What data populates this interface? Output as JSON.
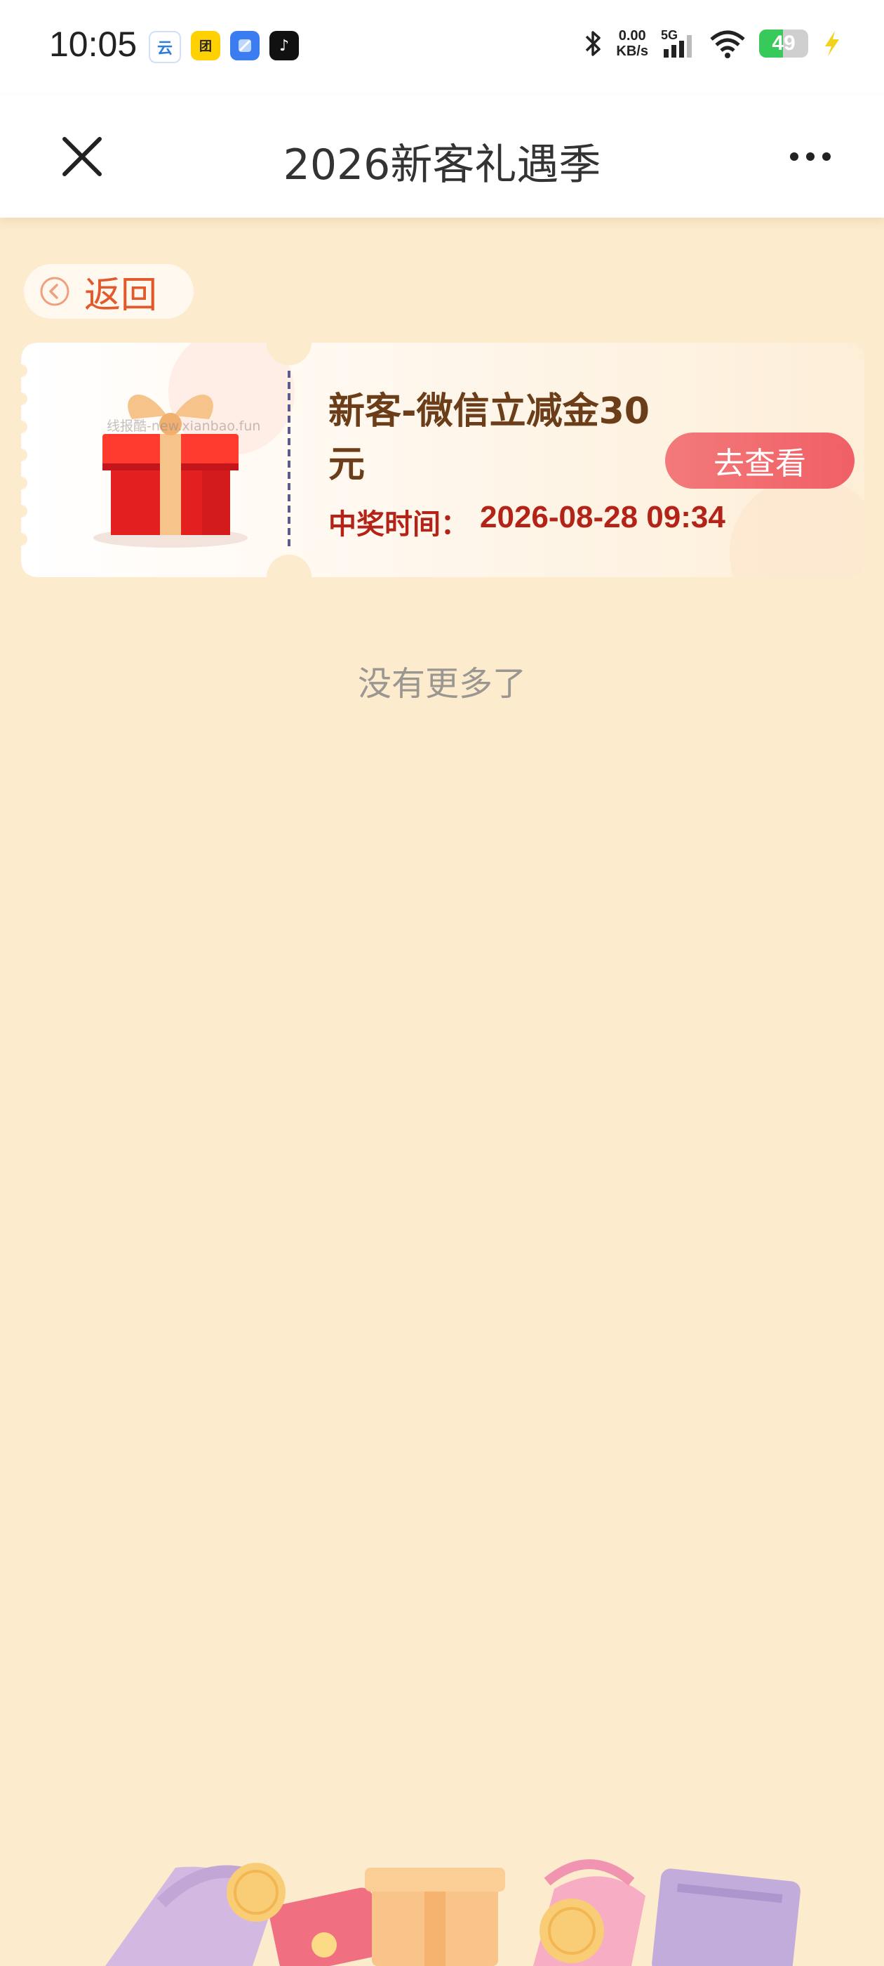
{
  "status_bar": {
    "time": "10:05",
    "apps": [
      {
        "icon": "weather-app-icon",
        "glyph": "云",
        "color": "#2f7de1"
      },
      {
        "icon": "meituan-app-icon",
        "glyph": "团",
        "color": "#ffd100"
      },
      {
        "icon": "notes-app-icon",
        "glyph": "",
        "color": "#3b7cf0"
      },
      {
        "icon": "douyin-app-icon",
        "glyph": "♪",
        "color": "#111111"
      }
    ],
    "net_speed_value": "0.00",
    "net_speed_unit": "KB/s",
    "network": "5G",
    "battery": 49
  },
  "nav": {
    "title": "2026新客礼遇季"
  },
  "back_button": {
    "label": "返回"
  },
  "prize": {
    "title": "新客-微信立减金30元",
    "time_label": "中奖时间：",
    "time_value": "2026-08-28 09:34",
    "action_label": "去查看",
    "watermark": "线报酷-new.xianbao.fun"
  },
  "list_end_text": "没有更多了",
  "colors": {
    "background": "#fcebcc",
    "accent_red": "#b42318",
    "title_brown": "#6b3d18",
    "button": "#f06a6e",
    "back_text": "#e25a2c"
  }
}
